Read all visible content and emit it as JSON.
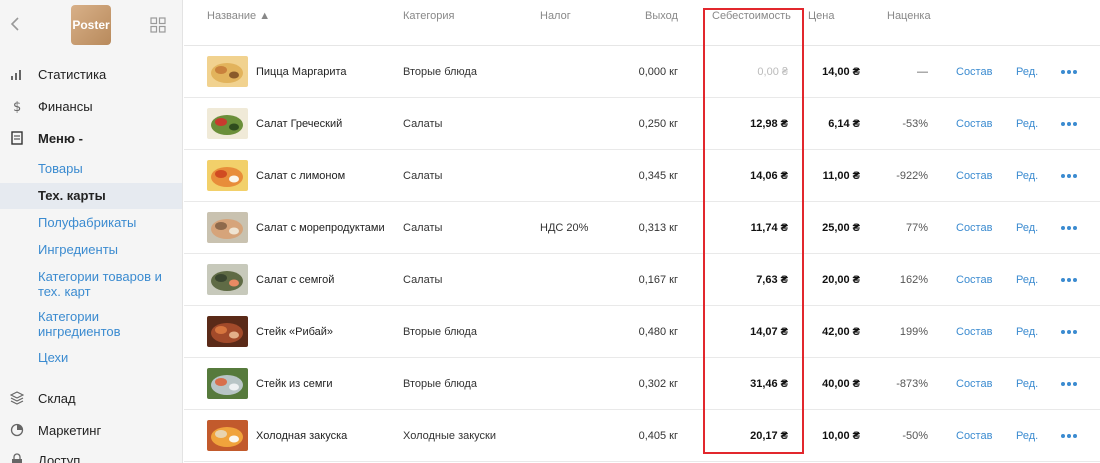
{
  "sidebar": {
    "logo_text": "Poster",
    "main_items": [
      {
        "label": "Статистика",
        "icon": "bar-chart-icon"
      },
      {
        "label": "Финансы",
        "icon": "dollar-icon"
      },
      {
        "label": "Меню -",
        "icon": "document-icon"
      },
      {
        "label": "Склад",
        "icon": "layers-icon"
      },
      {
        "label": "Маркетинг",
        "icon": "pie-chart-icon"
      },
      {
        "label": "Доступ",
        "icon": "lock-icon"
      }
    ],
    "menu_subitems": [
      {
        "label": "Товары"
      },
      {
        "label": "Тех. карты",
        "active": true
      },
      {
        "label": "Полуфабрикаты"
      },
      {
        "label": "Ингредиенты"
      },
      {
        "label": "Категории товаров и тех. карт"
      },
      {
        "label": "Категории ингредиентов"
      },
      {
        "label": "Цехи"
      }
    ]
  },
  "table": {
    "columns": [
      "Название ▲",
      "Категория",
      "Налог",
      "Выход",
      "Себестоимость",
      "Цена",
      "Наценка"
    ],
    "action_labels": {
      "composition": "Состав",
      "edit": "Ред."
    },
    "rows": [
      {
        "name": "Пицца Маргарита",
        "category": "Вторые блюда",
        "tax": "",
        "output": "0,000 кг",
        "cost": "0,00 ₴",
        "price": "14,00 ₴",
        "markup": "—",
        "thumb": "pizza"
      },
      {
        "name": "Салат Греческий",
        "category": "Салаты",
        "tax": "",
        "output": "0,250 кг",
        "cost": "12,98 ₴",
        "price": "6,14 ₴",
        "markup": "-53%",
        "thumb": "greek"
      },
      {
        "name": "Салат с лимоном",
        "category": "Салаты",
        "tax": "",
        "output": "0,345 кг",
        "cost": "14,06 ₴",
        "price": "11,00 ₴",
        "markup": "-922%",
        "thumb": "lemon"
      },
      {
        "name": "Салат с морепродуктами",
        "category": "Салаты",
        "tax": "НДС 20%",
        "output": "0,313 кг",
        "cost": "11,74 ₴",
        "price": "25,00 ₴",
        "markup": "77%",
        "thumb": "seafood"
      },
      {
        "name": "Салат с семгой",
        "category": "Салаты",
        "tax": "",
        "output": "0,167 кг",
        "cost": "7,63 ₴",
        "price": "20,00 ₴",
        "markup": "162%",
        "thumb": "salmon"
      },
      {
        "name": "Стейк «Рибай»",
        "category": "Вторые блюда",
        "tax": "",
        "output": "0,480 кг",
        "cost": "14,07 ₴",
        "price": "42,00 ₴",
        "markup": "199%",
        "thumb": "ribeye"
      },
      {
        "name": "Стейк из семги",
        "category": "Вторые блюда",
        "tax": "",
        "output": "0,302 кг",
        "cost": "31,46 ₴",
        "price": "40,00 ₴",
        "markup": "-873%",
        "thumb": "salmonsteak"
      },
      {
        "name": "Холодная закуска",
        "category": "Холодные закуски",
        "tax": "",
        "output": "0,405 кг",
        "cost": "20,17 ₴",
        "price": "10,00 ₴",
        "markup": "-50%",
        "thumb": "cold"
      }
    ]
  },
  "colors": {
    "link": "#3b8bd0",
    "highlight": "#e2272d"
  }
}
